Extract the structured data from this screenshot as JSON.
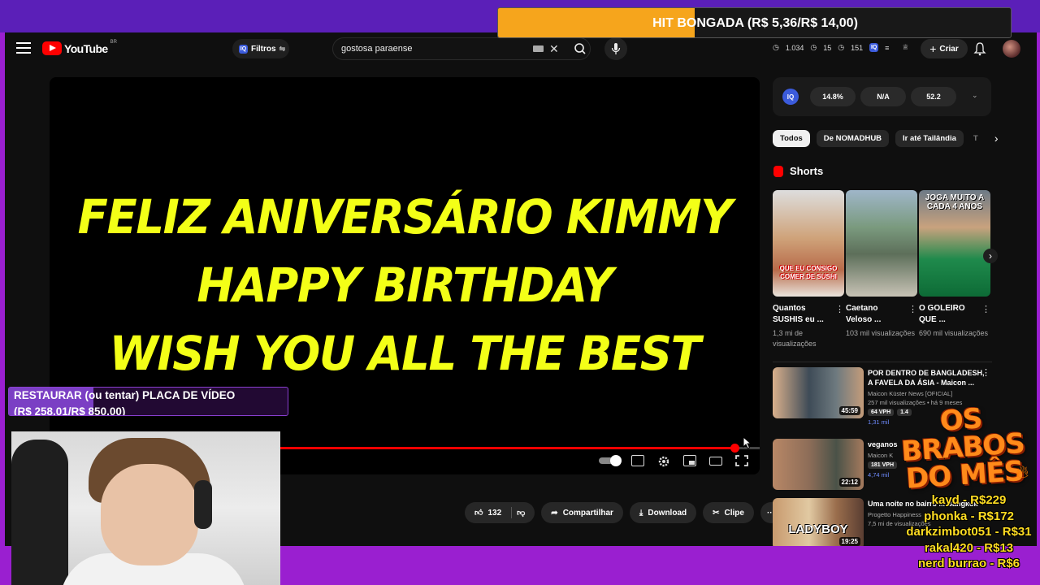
{
  "header": {
    "logo_text": "YouTube",
    "region": "BR",
    "filters_label": "Filtros",
    "search_value": "gostosa paraense",
    "stats": {
      "a": "1.034",
      "b": "15",
      "c": "151"
    },
    "create_label": "Criar"
  },
  "player": {
    "lines": [
      "FELIZ ANIVERSÁRIO KIMMY",
      "HAPPY BIRTHDAY",
      "WISH YOU ALL THE BEST"
    ],
    "progress": 0.965
  },
  "below_player": {
    "likes": "132",
    "share_label": "Compartilhar",
    "download_label": "Download",
    "clip_label": "Clipe"
  },
  "sidebar": {
    "iq_metrics": [
      "14.8%",
      "N/A",
      "52.2"
    ],
    "chips": [
      "Todos",
      "De NOMADHUB",
      "Ir até Tailândia",
      "T"
    ],
    "shorts_heading": "Shorts",
    "shorts": [
      {
        "title": "Quantos SUSHIS eu ...",
        "views": "1,3 mi de visualizações",
        "overlay": "QUE EU CONSIGO COMER DE SUSHI"
      },
      {
        "title": "Caetano Veloso ...",
        "views": "103 mil visualizações",
        "overlay": ""
      },
      {
        "title": "O GOLEIRO QUE ...",
        "views": "690 mil visualizações",
        "overlay": "JOGA MUITO A CADA 4 ANOS"
      }
    ],
    "recs": [
      {
        "title": "POR DENTRO DE BANGLADESH, A FAVELA DA ÁSIA - Maicon ...",
        "channel": "Maicon Küster News [OFICIAL]",
        "meta": "257 mil visualizações • há 9 meses",
        "vph": [
          "64 VPH",
          "1.4"
        ],
        "extra": "1,31 mil",
        "duration": "45:59"
      },
      {
        "title": "veganos",
        "channel": "Maicon K",
        "meta": "",
        "vph": [
          "181 VPH"
        ],
        "extra": "4,74 mil",
        "duration": "22:12"
      },
      {
        "title": "Uma noite no bairro ... Bangkok",
        "channel": "Progetto Happiness",
        "meta": "7,5 mi de visualizações",
        "vph": [],
        "extra": "",
        "duration": "19:25",
        "overlay": "LADYBOY"
      }
    ]
  },
  "overlays": {
    "top_goal": {
      "text": "HIT BONGADA (R$ 5,36/R$ 14,00)",
      "progress": 0.383
    },
    "left_goal": {
      "line1": "RESTAURAR (ou tentar) PLACA DE VÍDEO",
      "line2": "(R$ 258,01/R$ 850,00)",
      "progress": 0.304
    },
    "brabos_title": "OS BRABOS DO MÊS",
    "brabos": [
      "kayd - R$229",
      "phonka - R$172",
      "darkzimbot051 - R$31",
      "rakal420 - R$13",
      "nerd burrao - R$6"
    ]
  },
  "colors": {
    "accent_red": "#ff0000",
    "video_text": "#f3ff17",
    "frame_purple": "#9a1fd0",
    "goal_orange": "#f6a51c"
  },
  "icons": [
    "menu-icon",
    "youtube-logo-icon",
    "iq-icon",
    "keyboard-icon",
    "close-icon",
    "search-icon",
    "mic-icon",
    "plus-icon",
    "bell-icon",
    "like-icon",
    "dislike-icon",
    "share-icon",
    "download-icon",
    "scissors-icon",
    "more-icon",
    "settings-icon",
    "fullscreen-icon",
    "shorts-icon",
    "chevron-right-icon",
    "fire-icon"
  ]
}
